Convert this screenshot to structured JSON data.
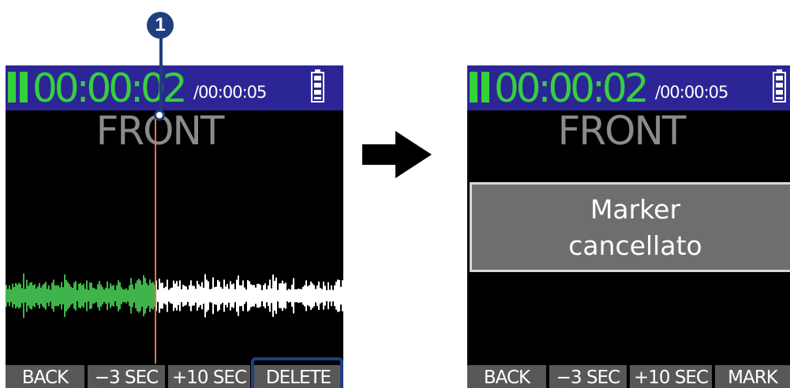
{
  "callout": {
    "number": "1"
  },
  "left_screen": {
    "elapsed": "00:00:02",
    "total": "/00:00:05",
    "channel": "FRONT",
    "softkeys": [
      "BACK",
      "−3 SEC",
      "+10 SEC",
      "DELETE"
    ]
  },
  "right_screen": {
    "elapsed": "00:00:02",
    "total": "/00:00:05",
    "channel": "FRONT",
    "popup_line1": "Marker",
    "popup_line2": "cancellato",
    "softkeys": [
      "BACK",
      "−3 SEC",
      "+10 SEC",
      "MARK"
    ]
  },
  "colors": {
    "status_bar": "#2c2596",
    "timecode": "#35d13b",
    "played_waveform": "#3fb44a",
    "unplayed_waveform": "#ffffff",
    "playhead": "#e0773a",
    "callout": "#1f3f7f"
  },
  "icons": {
    "battery": "battery-icon",
    "arrow": "right-arrow-icon",
    "pause": "pause-icon"
  }
}
